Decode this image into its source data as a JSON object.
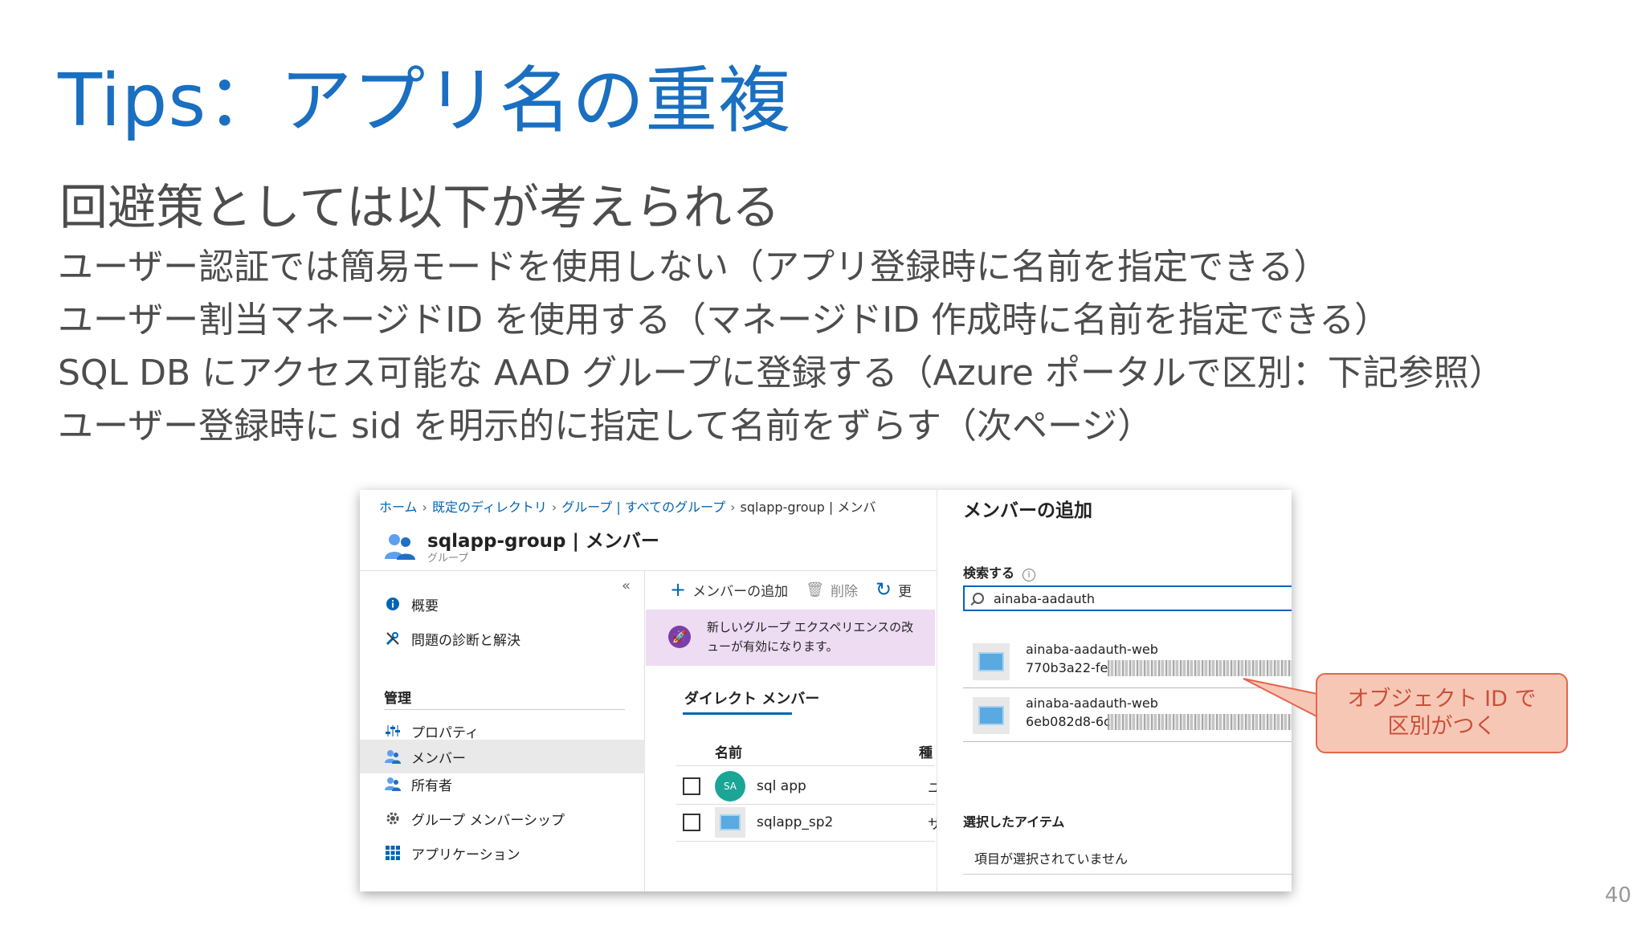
{
  "slide": {
    "title": "Tips：アプリ名の重複",
    "heading": "回避策としては以下が考えられる",
    "bullets": [
      "ユーザー認証では簡易モードを使用しない（アプリ登録時に名前を指定できる）",
      "ユーザー割当マネージドID を使用する（マネージドID 作成時に名前を指定できる）",
      "SQL DB にアクセス可能な AAD グループに登録する（Azure ポータルで区別：下記参照）",
      "ユーザー登録時に sid を明示的に指定して名前をずらす（次ページ）"
    ],
    "callout": {
      "line1": "オブジェクト ID で",
      "line2": "区別がつく"
    },
    "page_number": "40"
  },
  "portal": {
    "breadcrumb": [
      "ホーム",
      "既定のディレクトリ",
      "グループ | すべてのグループ",
      "sqlapp-group | メンバ"
    ],
    "group_title": "sqlapp-group | メンバー",
    "group_subtitle": "グループ",
    "collapse_glyph": "«",
    "nav": {
      "overview": "概要",
      "diagnose": "問題の診断と解決",
      "section_manage": "管理",
      "properties": "プロパティ",
      "members": "メンバー",
      "owners": "所有者",
      "group_memberships": "グループ メンバーシップ",
      "applications": "アプリケーション"
    },
    "toolbar": {
      "add_member": "メンバーの追加",
      "delete": "削除",
      "refresh": "更"
    },
    "banner": {
      "line1": "新しいグループ エクスペリエンスの改",
      "line2": "ューが有効になります。"
    },
    "tab_direct_members": "ダイレクト メンバー",
    "column_name": "名前",
    "column_second": "種",
    "members": [
      {
        "initials": "SA",
        "name": "sql app",
        "cut": "ユ"
      },
      {
        "initials": "",
        "name": "sqlapp_sp2",
        "cut": "サ"
      }
    ],
    "panel": {
      "title": "メンバーの追加",
      "search_label": "検索する",
      "info_glyph": "i",
      "search_value": "ainaba-aadauth",
      "results": [
        {
          "name": "ainaba-aadauth-web",
          "object_id": "770b3a22-fe"
        },
        {
          "name": "ainaba-aadauth-web",
          "object_id": "6eb082d8-6c"
        }
      ],
      "selected_label": "選択したアイテム",
      "none_selected": "項目が選択されていません"
    }
  },
  "colors": {
    "title_blue": "#1a6fc0",
    "azure_blue": "#0064b4",
    "banner_purple": "#eedcf3",
    "avatar_teal": "#1aa596",
    "callout_fill": "#f7c7b5",
    "callout_border": "#e3664e"
  },
  "icons": {
    "overview": "info-circle-icon",
    "diagnose": "wrench-icon",
    "properties": "sliders-icon",
    "members": "people-icon",
    "owners": "people-icon",
    "group_memberships": "gear-icon",
    "applications": "grid-icon",
    "add": "plus-icon",
    "delete": "trash-icon",
    "refresh": "refresh-icon",
    "search": "search-icon"
  }
}
